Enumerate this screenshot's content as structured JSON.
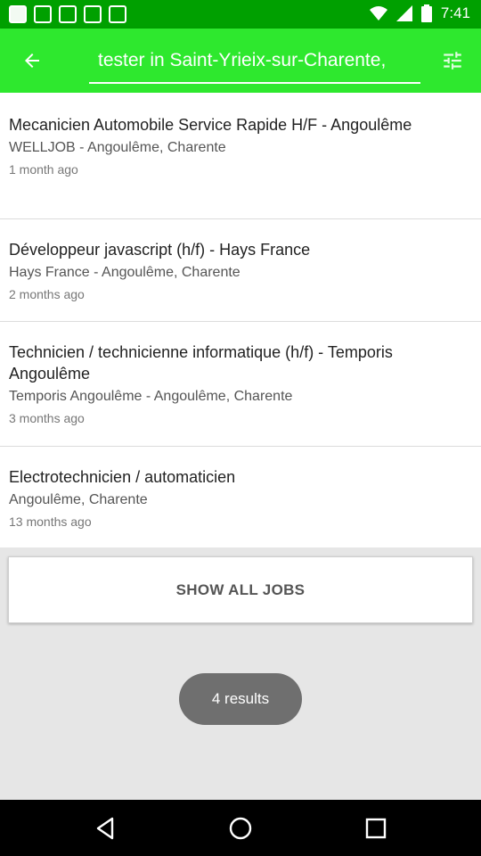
{
  "status_bar": {
    "time": "7:41",
    "icons": [
      "notification-square-icon",
      "notification-square-icon",
      "notification-square-icon",
      "notification-square-icon",
      "notification-square-icon",
      "wifi-icon",
      "signal-icon",
      "battery-icon"
    ]
  },
  "app_bar": {
    "search_value": "tester in Saint-Yrieix-sur-Charente,",
    "back_icon": "arrow-left-icon",
    "filter_icon": "tune-sliders-icon",
    "color": "#2ee82e"
  },
  "jobs": [
    {
      "title": "Mecanicien Automobile Service Rapide H/F - Angoulême",
      "company_location": "WELLJOB - Angoulême, Charente",
      "posted": "1 month ago"
    },
    {
      "title": "Développeur javascript (h/f) - Hays France",
      "company_location": "Hays France - Angoulême, Charente",
      "posted": "2 months ago"
    },
    {
      "title": "Technicien / technicienne informatique (h/f) - Temporis Angoulême",
      "company_location": "Temporis Angoulême - Angoulême, Charente",
      "posted": "3 months ago"
    },
    {
      "title": "Electrotechnicien / automaticien",
      "company_location": "Angoulême, Charente",
      "posted": "13 months ago"
    }
  ],
  "show_all_label": "SHOW ALL JOBS",
  "results_label": "4 results",
  "nav": {
    "back": "nav-back-icon",
    "home": "nav-home-icon",
    "recents": "nav-recents-icon"
  }
}
